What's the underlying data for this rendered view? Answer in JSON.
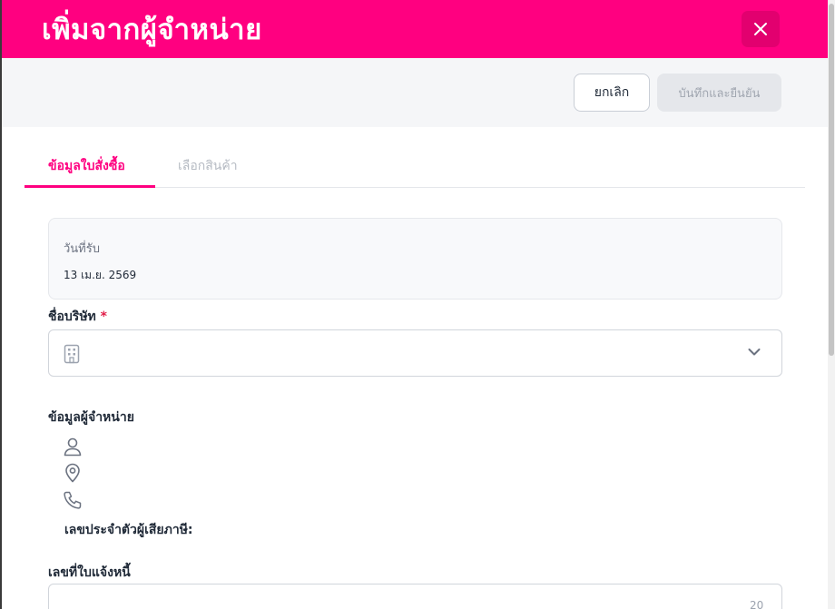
{
  "header": {
    "title": "เพิ่มจากผู้จำหน่าย"
  },
  "toolbar": {
    "cancel_label": "ยกเลิก",
    "save_label": "บันทึกและยืนยัน"
  },
  "tabs": [
    {
      "label": "ข้อมูลใบสั่งซื้อ",
      "active": true
    },
    {
      "label": "เลือกสินค้า",
      "active": false
    }
  ],
  "receive_date": {
    "label": "วันที่รับ",
    "value": "13 เม.ย. 2569"
  },
  "company": {
    "label": "ชื่อบริษัท",
    "required_mark": "*"
  },
  "vendor_info": {
    "label": "ข้อมูลผู้จำหน่าย",
    "tax_id_label": "เลขประจำตัวผู้เสียภาษี:"
  },
  "invoice": {
    "label": "เลขที่ใบแจ้งหนี้",
    "char_limit": "20"
  },
  "colors": {
    "brand": "#ff0080",
    "brand_dark": "#e2006f"
  },
  "icons": [
    "close-icon",
    "building-icon",
    "chevron-down-icon",
    "user-icon",
    "map-pin-icon",
    "phone-icon"
  ]
}
